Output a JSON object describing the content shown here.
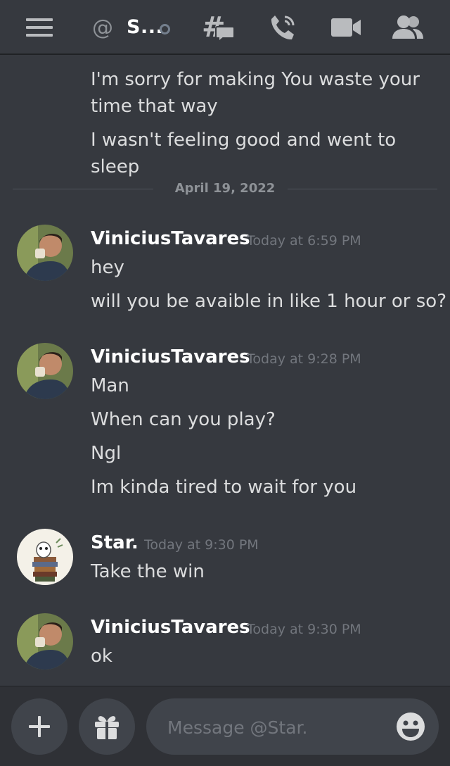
{
  "header": {
    "at_symbol": "@",
    "dm_name": "S...",
    "icons": [
      "hamburger-icon",
      "threads-icon",
      "call-icon",
      "video-icon",
      "members-icon"
    ]
  },
  "messages": {
    "continued": [
      "I'm sorry for making You waste your time that way",
      "I wasn't feeling good and went to sleep"
    ],
    "date_divider": "April 19, 2022",
    "groups": [
      {
        "author": "ViniciusTavares",
        "timestamp": "Today at 6:59 PM",
        "lines": [
          "hey",
          "will you be avaible in like 1 hour or so?"
        ]
      },
      {
        "author": "ViniciusTavares",
        "timestamp": "Today at 9:28 PM",
        "lines": [
          "Man",
          "When can you play?",
          "Ngl",
          "Im kinda tired to wait for you"
        ]
      },
      {
        "author": "Star.",
        "timestamp": "Today at 9:30 PM",
        "lines": [
          "Take the win"
        ]
      },
      {
        "author": "ViniciusTavares",
        "timestamp": "Today at 9:30 PM",
        "lines": [
          "ok"
        ]
      }
    ]
  },
  "composer": {
    "placeholder": "Message @Star."
  },
  "colors": {
    "background": "#36393f",
    "composer_bar": "#2f3136",
    "input_bg": "#40444b",
    "text": "#dcddde",
    "muted": "#72767d"
  }
}
